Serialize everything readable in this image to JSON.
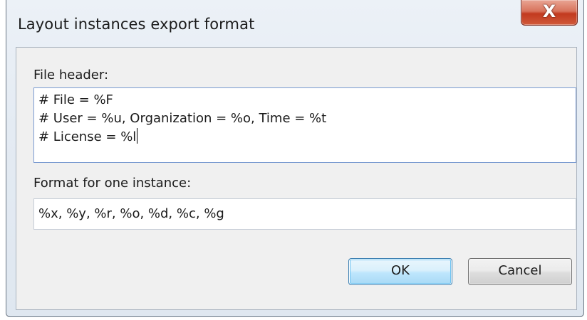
{
  "window": {
    "title": "Layout instances export format",
    "close_label": "X"
  },
  "file_header": {
    "label": "File header:",
    "lines": [
      "# File = %F",
      "# User = %u, Organization = %o, Time = %t",
      "# License = %l"
    ]
  },
  "instance_format": {
    "label": "Format for one instance:",
    "value": "%x, %y, %r, %o, %d, %c, %g"
  },
  "buttons": {
    "ok_label": "OK",
    "cancel_label": "Cancel"
  }
}
